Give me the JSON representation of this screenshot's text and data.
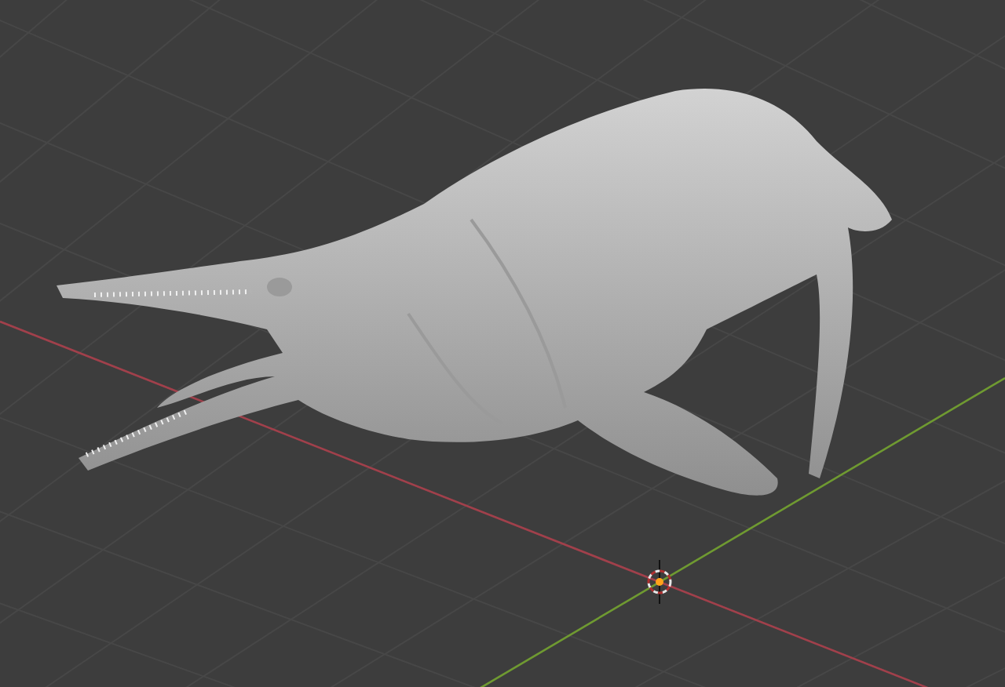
{
  "viewport": {
    "axes": [
      {
        "kind": "x",
        "color": "#a1404b"
      },
      {
        "kind": "y",
        "color": "#6f9a31"
      }
    ],
    "cursor_visible": true
  }
}
